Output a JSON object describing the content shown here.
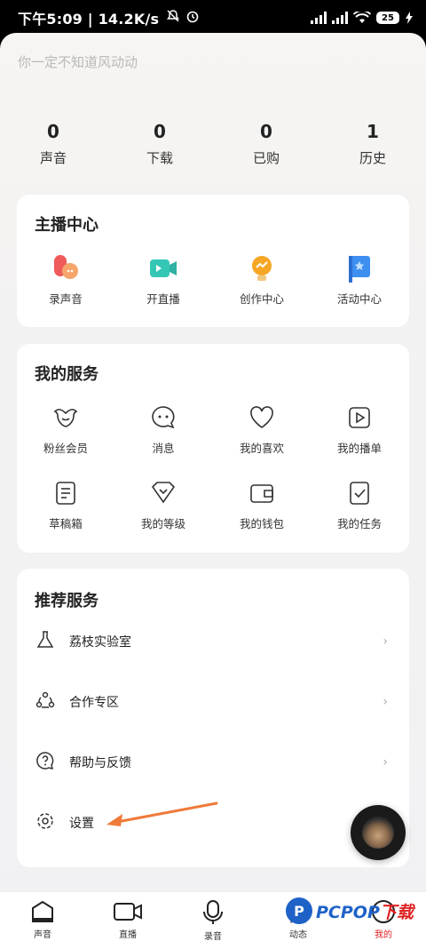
{
  "status_bar": {
    "time_net": "下午5:09 | 14.2K/s",
    "battery": "25"
  },
  "header": {
    "hint": "你一定不知道风动动"
  },
  "stats": [
    {
      "value": "0",
      "label": "声音"
    },
    {
      "value": "0",
      "label": "下载"
    },
    {
      "value": "0",
      "label": "已购"
    },
    {
      "value": "1",
      "label": "历史"
    }
  ],
  "host_center": {
    "title": "主播中心",
    "items": [
      {
        "label": "录声音",
        "icon": "record-voice-icon"
      },
      {
        "label": "开直播",
        "icon": "live-camera-icon"
      },
      {
        "label": "创作中心",
        "icon": "creation-bulb-icon"
      },
      {
        "label": "活动中心",
        "icon": "activity-flag-icon"
      }
    ]
  },
  "my_services": {
    "title": "我的服务",
    "items": [
      {
        "label": "粉丝会员",
        "icon": "fan-member-icon"
      },
      {
        "label": "消息",
        "icon": "message-icon"
      },
      {
        "label": "我的喜欢",
        "icon": "heart-icon"
      },
      {
        "label": "我的播单",
        "icon": "playlist-icon"
      },
      {
        "label": "草稿箱",
        "icon": "draft-icon"
      },
      {
        "label": "我的等级",
        "icon": "level-icon"
      },
      {
        "label": "我的钱包",
        "icon": "wallet-icon"
      },
      {
        "label": "我的任务",
        "icon": "task-icon"
      }
    ]
  },
  "recommended": {
    "title": "推荐服务",
    "items": [
      {
        "label": "荔枝实验室",
        "icon": "flask-icon",
        "chevron": "›"
      },
      {
        "label": "合作专区",
        "icon": "cooperation-icon",
        "chevron": "›"
      },
      {
        "label": "帮助与反馈",
        "icon": "help-icon",
        "chevron": "›"
      },
      {
        "label": "设置",
        "icon": "settings-gear-icon",
        "chevron": ""
      }
    ]
  },
  "bottom_nav": [
    {
      "label": "声音",
      "icon": "home-sound-icon"
    },
    {
      "label": "直播",
      "icon": "live-icon"
    },
    {
      "label": "录音",
      "icon": "microphone-icon"
    },
    {
      "label": "动态",
      "icon": "star-feed-icon"
    },
    {
      "label": "我的",
      "icon": "profile-icon"
    }
  ],
  "watermark": {
    "logo_letter": "P",
    "brand": "PCPOP",
    "suffix": "下载"
  },
  "colors": {
    "accent_orange": "#f07a3a",
    "active_red": "#e02121",
    "brand_blue": "#1e62c8"
  }
}
